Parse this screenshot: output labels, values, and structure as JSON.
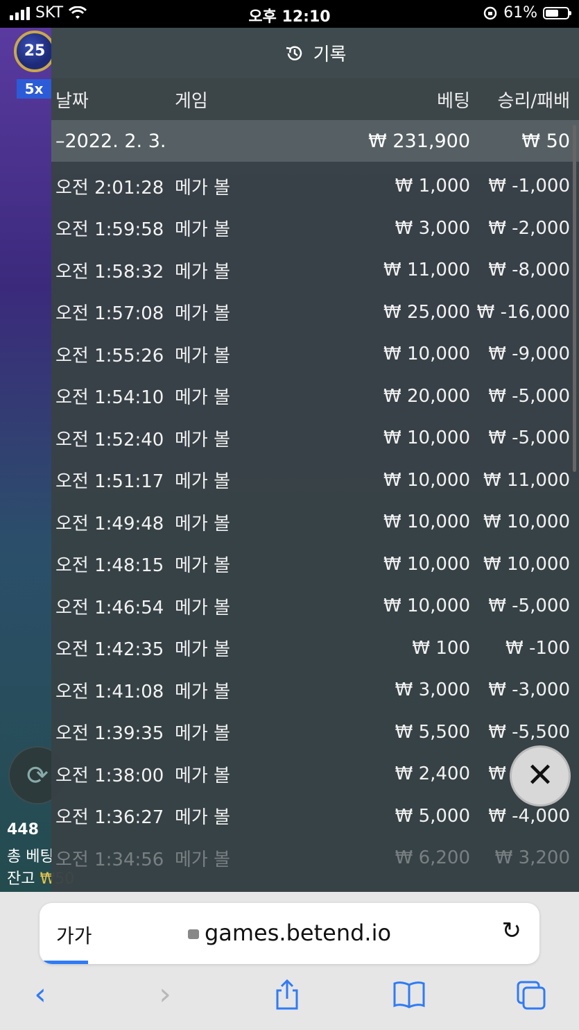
{
  "status": {
    "carrier": "SKT",
    "time": "오후 12:10",
    "battery": "61%",
    "battery_level": 0.61
  },
  "game": {
    "badge_number": "25",
    "multiplier": "5x",
    "count": "448",
    "total_bet_label": "총 베팅",
    "balance_label": "잔고",
    "balance_value": "₩50"
  },
  "history": {
    "title": "기록",
    "columns": {
      "date": "날짜",
      "game": "게임",
      "bet": "베팅",
      "win_loss": "승리/패배"
    },
    "summary": {
      "date": "–2022. 2. 3.",
      "bet": "₩ 231,900",
      "win_loss": "₩ 50"
    },
    "rows": [
      {
        "time": "오전 2:01:28",
        "game": "메가 볼",
        "bet": "₩ 1,000",
        "win_loss": "₩ -1,000"
      },
      {
        "time": "오전 1:59:58",
        "game": "메가 볼",
        "bet": "₩ 3,000",
        "win_loss": "₩ -2,000"
      },
      {
        "time": "오전 1:58:32",
        "game": "메가 볼",
        "bet": "₩ 11,000",
        "win_loss": "₩ -8,000"
      },
      {
        "time": "오전 1:57:08",
        "game": "메가 볼",
        "bet": "₩ 25,000",
        "win_loss": "₩ -16,000"
      },
      {
        "time": "오전 1:55:26",
        "game": "메가 볼",
        "bet": "₩ 10,000",
        "win_loss": "₩ -9,000"
      },
      {
        "time": "오전 1:54:10",
        "game": "메가 볼",
        "bet": "₩ 20,000",
        "win_loss": "₩ -5,000"
      },
      {
        "time": "오전 1:52:40",
        "game": "메가 볼",
        "bet": "₩ 10,000",
        "win_loss": "₩ -5,000"
      },
      {
        "time": "오전 1:51:17",
        "game": "메가 볼",
        "bet": "₩ 10,000",
        "win_loss": "₩ 11,000"
      },
      {
        "time": "오전 1:49:48",
        "game": "메가 볼",
        "bet": "₩ 10,000",
        "win_loss": "₩ 10,000"
      },
      {
        "time": "오전 1:48:15",
        "game": "메가 볼",
        "bet": "₩ 10,000",
        "win_loss": "₩ 10,000"
      },
      {
        "time": "오전 1:46:54",
        "game": "메가 볼",
        "bet": "₩ 10,000",
        "win_loss": "₩ -5,000"
      },
      {
        "time": "오전 1:42:35",
        "game": "메가 볼",
        "bet": "₩ 100",
        "win_loss": "₩ -100"
      },
      {
        "time": "오전 1:41:08",
        "game": "메가 볼",
        "bet": "₩ 3,000",
        "win_loss": "₩ -3,000"
      },
      {
        "time": "오전 1:39:35",
        "game": "메가 볼",
        "bet": "₩ 5,500",
        "win_loss": "₩ -5,500"
      },
      {
        "time": "오전 1:38:00",
        "game": "메가 볼",
        "bet": "₩ 2,400",
        "win_loss": "₩ -1,000"
      },
      {
        "time": "오전 1:36:27",
        "game": "메가 볼",
        "bet": "₩ 5,000",
        "win_loss": "₩ -4,000"
      },
      {
        "time": "오전 1:34:56",
        "game": "메가 볼",
        "bet": "₩ 6,200",
        "win_loss": "₩ 3,200"
      }
    ]
  },
  "browser": {
    "text_size_label": "가가",
    "url": "games.betend.io"
  },
  "icons": {
    "history": "history-clock-icon",
    "close": "close-x-icon",
    "reload": "reload-icon",
    "back": "back-chevron-icon",
    "forward": "forward-chevron-icon",
    "share": "share-icon",
    "bookmarks": "bookmarks-book-icon",
    "tabs": "tabs-icon"
  },
  "colors": {
    "accent": "#2f7bf5",
    "panel": "#384246",
    "summary_row": "#566064"
  }
}
